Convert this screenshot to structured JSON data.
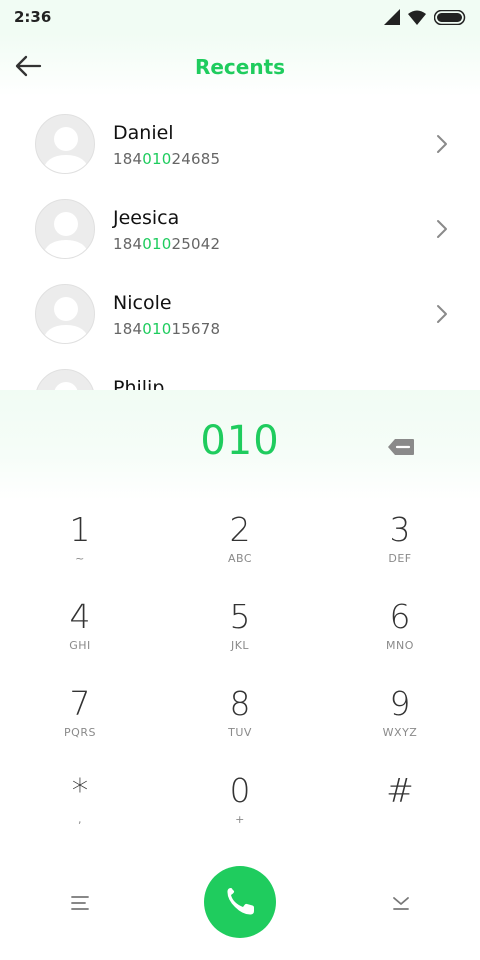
{
  "status": {
    "time": "2:36"
  },
  "header": {
    "title": "Recents"
  },
  "recents": [
    {
      "name": "Daniel",
      "number_prefix": "184",
      "number_match": "010",
      "number_suffix": "24685"
    },
    {
      "name": "Jeesica",
      "number_prefix": "184",
      "number_match": "010",
      "number_suffix": "25042"
    },
    {
      "name": "Nicole",
      "number_prefix": "184",
      "number_match": "010",
      "number_suffix": "15678"
    },
    {
      "name": "Philip",
      "number_prefix": "",
      "number_match": "",
      "number_suffix": ""
    }
  ],
  "dialer": {
    "input": "010"
  },
  "keypad": [
    {
      "digit": "1",
      "letters": "~"
    },
    {
      "digit": "2",
      "letters": "ABC"
    },
    {
      "digit": "3",
      "letters": "DEF"
    },
    {
      "digit": "4",
      "letters": "GHI"
    },
    {
      "digit": "5",
      "letters": "JKL"
    },
    {
      "digit": "6",
      "letters": "MNO"
    },
    {
      "digit": "7",
      "letters": "PQRS"
    },
    {
      "digit": "8",
      "letters": "TUV"
    },
    {
      "digit": "9",
      "letters": "WXYZ"
    },
    {
      "digit": "*",
      "letters": ","
    },
    {
      "digit": "0",
      "letters": "+"
    },
    {
      "digit": "#",
      "letters": ""
    }
  ],
  "colors": {
    "accent": "#1fcc5e"
  },
  "icons": {
    "back": "arrow-left-icon",
    "chevron": "chevron-right-icon",
    "backspace": "backspace-icon",
    "menu": "menu-lines-icon",
    "call": "phone-icon",
    "collapse": "chevron-down-bar-icon"
  }
}
